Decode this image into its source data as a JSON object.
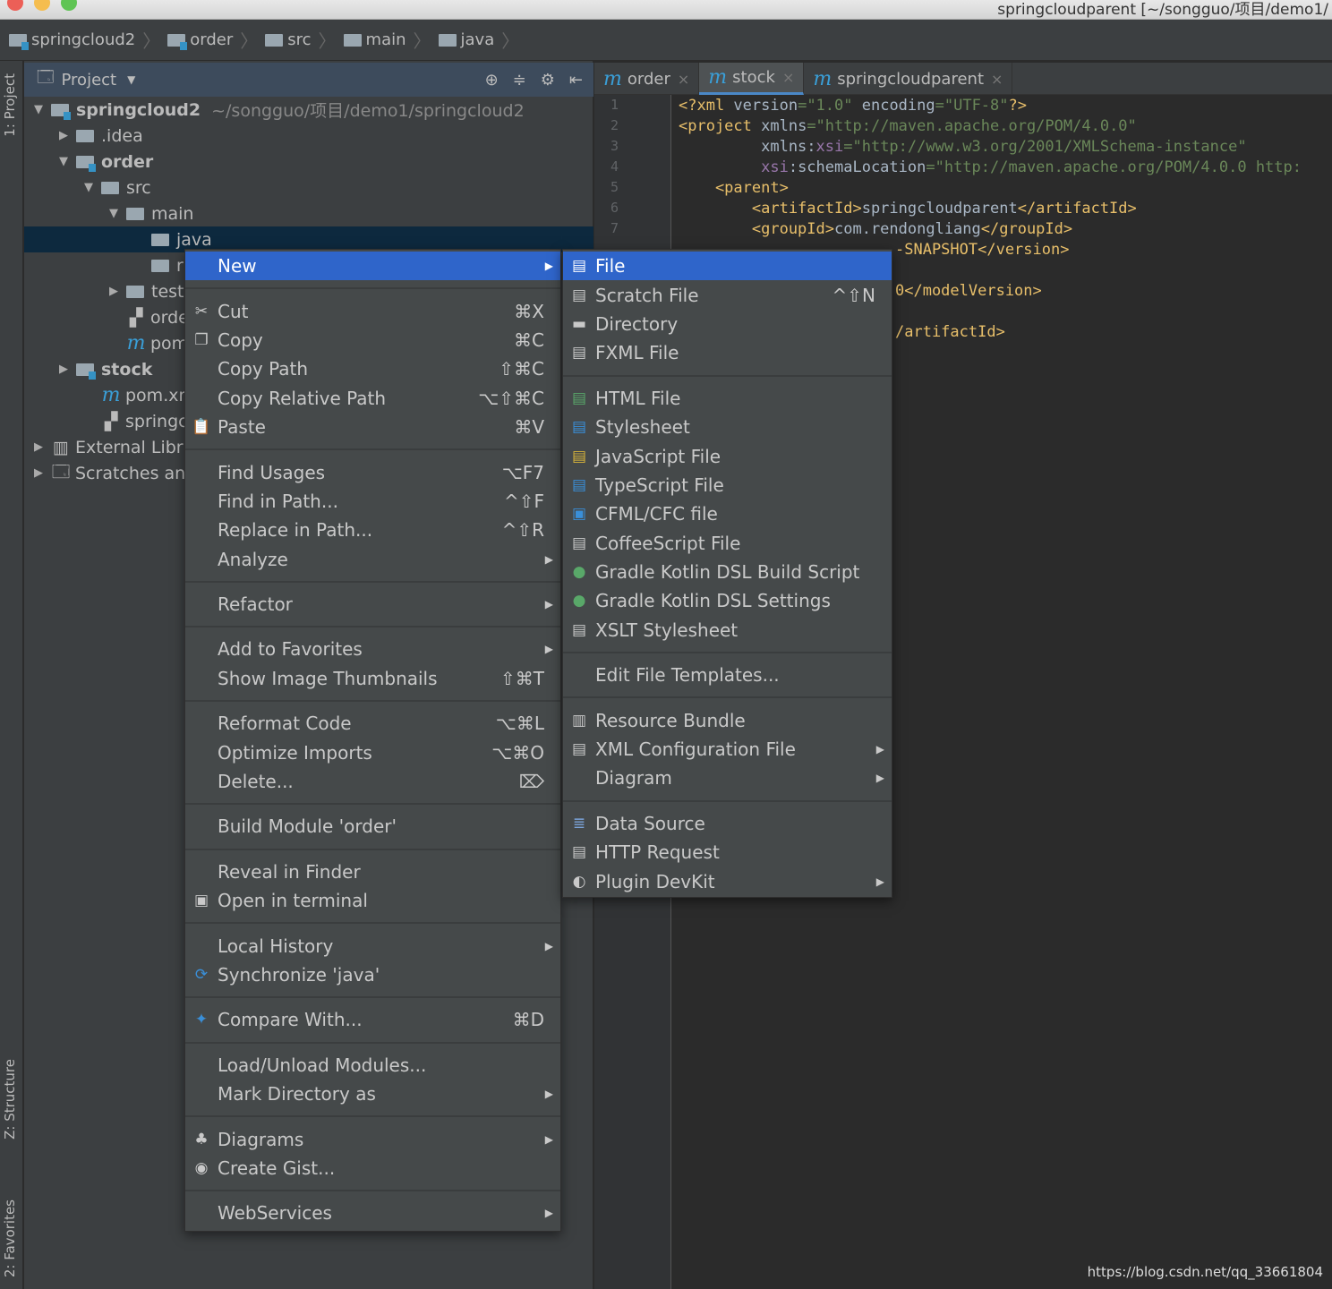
{
  "window": {
    "title": "springcloudparent [~/songguo/项目/demo1/"
  },
  "breadcrumb": [
    "springcloud2",
    "order",
    "src",
    "main",
    "java"
  ],
  "side_tabs": {
    "project": "1: Project",
    "structure": "Z: Structure",
    "favorites": "2: Favorites"
  },
  "project_panel": {
    "title": "Project",
    "tree": [
      {
        "label": "springcloud2",
        "extra": "~/songguo/项目/demo1/springcloud2",
        "indent": 0,
        "arrow": "down",
        "icon": "module",
        "bold": true
      },
      {
        "label": ".idea",
        "indent": 1,
        "arrow": "right",
        "icon": "folder"
      },
      {
        "label": "order",
        "indent": 1,
        "arrow": "down",
        "icon": "module",
        "bold": true
      },
      {
        "label": "src",
        "indent": 2,
        "arrow": "down",
        "icon": "folder"
      },
      {
        "label": "main",
        "indent": 3,
        "arrow": "down",
        "icon": "folder"
      },
      {
        "label": "java",
        "indent": 4,
        "arrow": "",
        "icon": "folder",
        "selected": true
      },
      {
        "label": "r",
        "indent": 4,
        "arrow": "",
        "icon": "folder"
      },
      {
        "label": "test",
        "indent": 3,
        "arrow": "right",
        "icon": "folder"
      },
      {
        "label": "order.i",
        "indent": 3,
        "arrow": "",
        "icon": "iml"
      },
      {
        "label": "pom.x",
        "indent": 3,
        "arrow": "",
        "icon": "maven"
      },
      {
        "label": "stock",
        "indent": 1,
        "arrow": "right",
        "icon": "module",
        "bold": true
      },
      {
        "label": "pom.xml",
        "indent": 2,
        "arrow": "",
        "icon": "maven"
      },
      {
        "label": "springclo",
        "indent": 2,
        "arrow": "",
        "icon": "iml"
      },
      {
        "label": "External Libr",
        "indent": 0,
        "arrow": "right",
        "icon": "library"
      },
      {
        "label": "Scratches an",
        "indent": 0,
        "arrow": "right",
        "icon": "scratches"
      }
    ]
  },
  "editor": {
    "tabs": [
      {
        "label": "order",
        "active": false
      },
      {
        "label": "stock",
        "active": true
      },
      {
        "label": "springcloudparent",
        "active": false
      }
    ],
    "lines": [
      "1",
      "2",
      "3",
      "4",
      "5",
      "6",
      "7"
    ],
    "code": [
      [
        [
          "tg",
          "<?xml "
        ],
        [
          "",
          "version"
        ],
        [
          "av",
          "=\"1.0\" "
        ],
        [
          "",
          "encoding"
        ],
        [
          "av",
          "=\"UTF-8\""
        ],
        [
          "tg",
          "?>"
        ]
      ],
      [
        [
          "tg",
          "<project "
        ],
        [
          "",
          "xmlns"
        ],
        [
          "av",
          "=\"http://maven.apache.org/POM/4.0.0\""
        ]
      ],
      [
        [
          "",
          "         xmlns:"
        ],
        [
          "ns",
          "xsi"
        ],
        [
          "av",
          "=\"http://www.w3.org/2001/XMLSchema-instance\""
        ]
      ],
      [
        [
          "ns",
          "         xsi"
        ],
        [
          "",
          ":schemaLocation"
        ],
        [
          "av",
          "=\"http://maven.apache.org/POM/4.0.0 http:"
        ]
      ],
      [
        [
          "tg",
          "    <parent>"
        ]
      ],
      [
        [
          "tg",
          "        <artifactId>"
        ],
        [
          "",
          "springcloudparent"
        ],
        [
          "tg",
          "</artifactId>"
        ]
      ],
      [
        [
          "tg",
          "        <groupId>"
        ],
        [
          "",
          "com.rendongliang"
        ],
        [
          "tg",
          "</groupId>"
        ]
      ]
    ],
    "fragments": [
      {
        "text": "-SNAPSHOT</version>",
        "line": 8
      },
      {
        "text": "0</modelVersion>",
        "line": 10
      },
      {
        "text": "/artifactId>",
        "line": 12
      }
    ]
  },
  "context_menu": [
    {
      "label": "New",
      "sub": true,
      "hl": true
    },
    "sep",
    {
      "label": "Cut",
      "sc": "⌘X",
      "icon": "scissors"
    },
    {
      "label": "Copy",
      "sc": "⌘C",
      "icon": "copy"
    },
    {
      "label": "Copy Path",
      "sc": "⇧⌘C"
    },
    {
      "label": "Copy Relative Path",
      "sc": "⌥⇧⌘C"
    },
    {
      "label": "Paste",
      "sc": "⌘V",
      "icon": "paste"
    },
    "sep",
    {
      "label": "Find Usages",
      "sc": "⌥F7"
    },
    {
      "label": "Find in Path...",
      "sc": "^⇧F"
    },
    {
      "label": "Replace in Path...",
      "sc": "^⇧R"
    },
    {
      "label": "Analyze",
      "sub": true
    },
    "sep",
    {
      "label": "Refactor",
      "sub": true
    },
    "sep",
    {
      "label": "Add to Favorites",
      "sub": true
    },
    {
      "label": "Show Image Thumbnails",
      "sc": "⇧⌘T"
    },
    "sep",
    {
      "label": "Reformat Code",
      "sc": "⌥⌘L"
    },
    {
      "label": "Optimize Imports",
      "sc": "⌥⌘O"
    },
    {
      "label": "Delete...",
      "sc": "⌦"
    },
    "sep",
    {
      "label": "Build Module 'order'"
    },
    "sep",
    {
      "label": "Reveal in Finder"
    },
    {
      "label": "Open in terminal",
      "icon": "terminal"
    },
    "sep",
    {
      "label": "Local History",
      "sub": true
    },
    {
      "label": "Synchronize 'java'",
      "icon": "sync"
    },
    "sep",
    {
      "label": "Compare With...",
      "sc": "⌘D",
      "icon": "compare"
    },
    "sep",
    {
      "label": "Load/Unload Modules..."
    },
    {
      "label": "Mark Directory as",
      "sub": true
    },
    "sep",
    {
      "label": "Diagrams",
      "sub": true,
      "icon": "diagram"
    },
    {
      "label": "Create Gist...",
      "icon": "github"
    },
    "sep",
    {
      "label": "WebServices",
      "sub": true
    }
  ],
  "new_submenu": [
    {
      "label": "File",
      "hl": true,
      "icon": "file"
    },
    {
      "label": "Scratch File",
      "sc": "^⇧N",
      "icon": "scratch"
    },
    {
      "label": "Directory",
      "icon": "folder"
    },
    {
      "label": "FXML File",
      "icon": "fxml"
    },
    "sep",
    {
      "label": "HTML File",
      "icon": "html"
    },
    {
      "label": "Stylesheet",
      "icon": "css"
    },
    {
      "label": "JavaScript File",
      "icon": "js"
    },
    {
      "label": "TypeScript File",
      "icon": "ts"
    },
    {
      "label": "CFML/CFC file",
      "icon": "cf"
    },
    {
      "label": "CoffeeScript File",
      "icon": "coffee"
    },
    {
      "label": "Gradle Kotlin DSL Build Script",
      "icon": "gradle"
    },
    {
      "label": "Gradle Kotlin DSL Settings",
      "icon": "gradle"
    },
    {
      "label": "XSLT Stylesheet",
      "icon": "xslt"
    },
    "sep",
    {
      "label": "Edit File Templates..."
    },
    "sep",
    {
      "label": "Resource Bundle",
      "icon": "bundle"
    },
    {
      "label": "XML Configuration File",
      "sub": true,
      "icon": "xml"
    },
    {
      "label": "Diagram",
      "sub": true
    },
    "sep",
    {
      "label": "Data Source",
      "icon": "database"
    },
    {
      "label": "HTTP Request",
      "icon": "api"
    },
    {
      "label": "Plugin DevKit",
      "sub": true,
      "icon": "plugin"
    }
  ],
  "watermark": "https://blog.csdn.net/qq_33661804",
  "colors": {
    "highlight": "#2f65ca",
    "tag": "#e8bf6a",
    "string": "#6a8759",
    "namespace": "#9876aa"
  }
}
